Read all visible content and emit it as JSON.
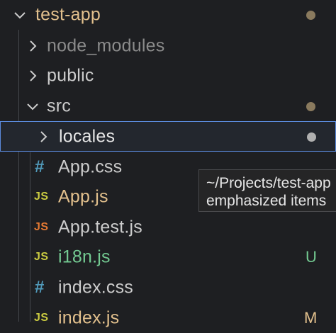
{
  "colors": {
    "background": "#1e1f22",
    "root_label": "#e2c08d",
    "folder_label": "#cccccc",
    "ignored_label": "#8b8b8b",
    "untracked_label": "#73c991",
    "modified_label": "#e2c08d",
    "untracked_badge": "#73c991",
    "modified_badge": "#e2c08d",
    "js_icon": "#cbcb41",
    "js_test_icon": "#e37933",
    "css_icon": "#519aba",
    "dot": "#8a7a5e",
    "selection_border": "#5b8bdd"
  },
  "explorer": {
    "root": {
      "label": "test-app",
      "icon": "chevron-down-icon",
      "indicator": "modified-dot"
    },
    "items": [
      {
        "label": "node_modules",
        "icon": "chevron-right-icon",
        "type": "folder",
        "state": "ignored"
      },
      {
        "label": "public",
        "icon": "chevron-right-icon",
        "type": "folder",
        "state": "normal"
      },
      {
        "label": "src",
        "icon": "chevron-down-icon",
        "type": "folder",
        "state": "expanded",
        "indicator": "modified-dot"
      },
      {
        "label": "locales",
        "icon": "chevron-right-icon",
        "type": "folder",
        "state": "selected",
        "indicator": "dot"
      },
      {
        "label": "App.css",
        "icon": "css-file-icon",
        "icon_glyph": "#",
        "type": "file"
      },
      {
        "label": "App.js",
        "icon": "js-file-icon",
        "icon_glyph": "JS",
        "type": "file",
        "state": "modified"
      },
      {
        "label": "App.test.js",
        "icon": "js-test-file-icon",
        "icon_glyph": "JS",
        "type": "file"
      },
      {
        "label": "i18n.js",
        "icon": "js-file-icon",
        "icon_glyph": "JS",
        "type": "file",
        "state": "untracked",
        "badge": "U"
      },
      {
        "label": "index.css",
        "icon": "css-file-icon",
        "icon_glyph": "#",
        "type": "file"
      },
      {
        "label": "index.js",
        "icon": "js-file-icon",
        "icon_glyph": "JS",
        "type": "file",
        "state": "modified",
        "badge": "M"
      }
    ]
  },
  "tooltip": {
    "line1": "~/Projects/test-app",
    "line2": "emphasized items"
  }
}
